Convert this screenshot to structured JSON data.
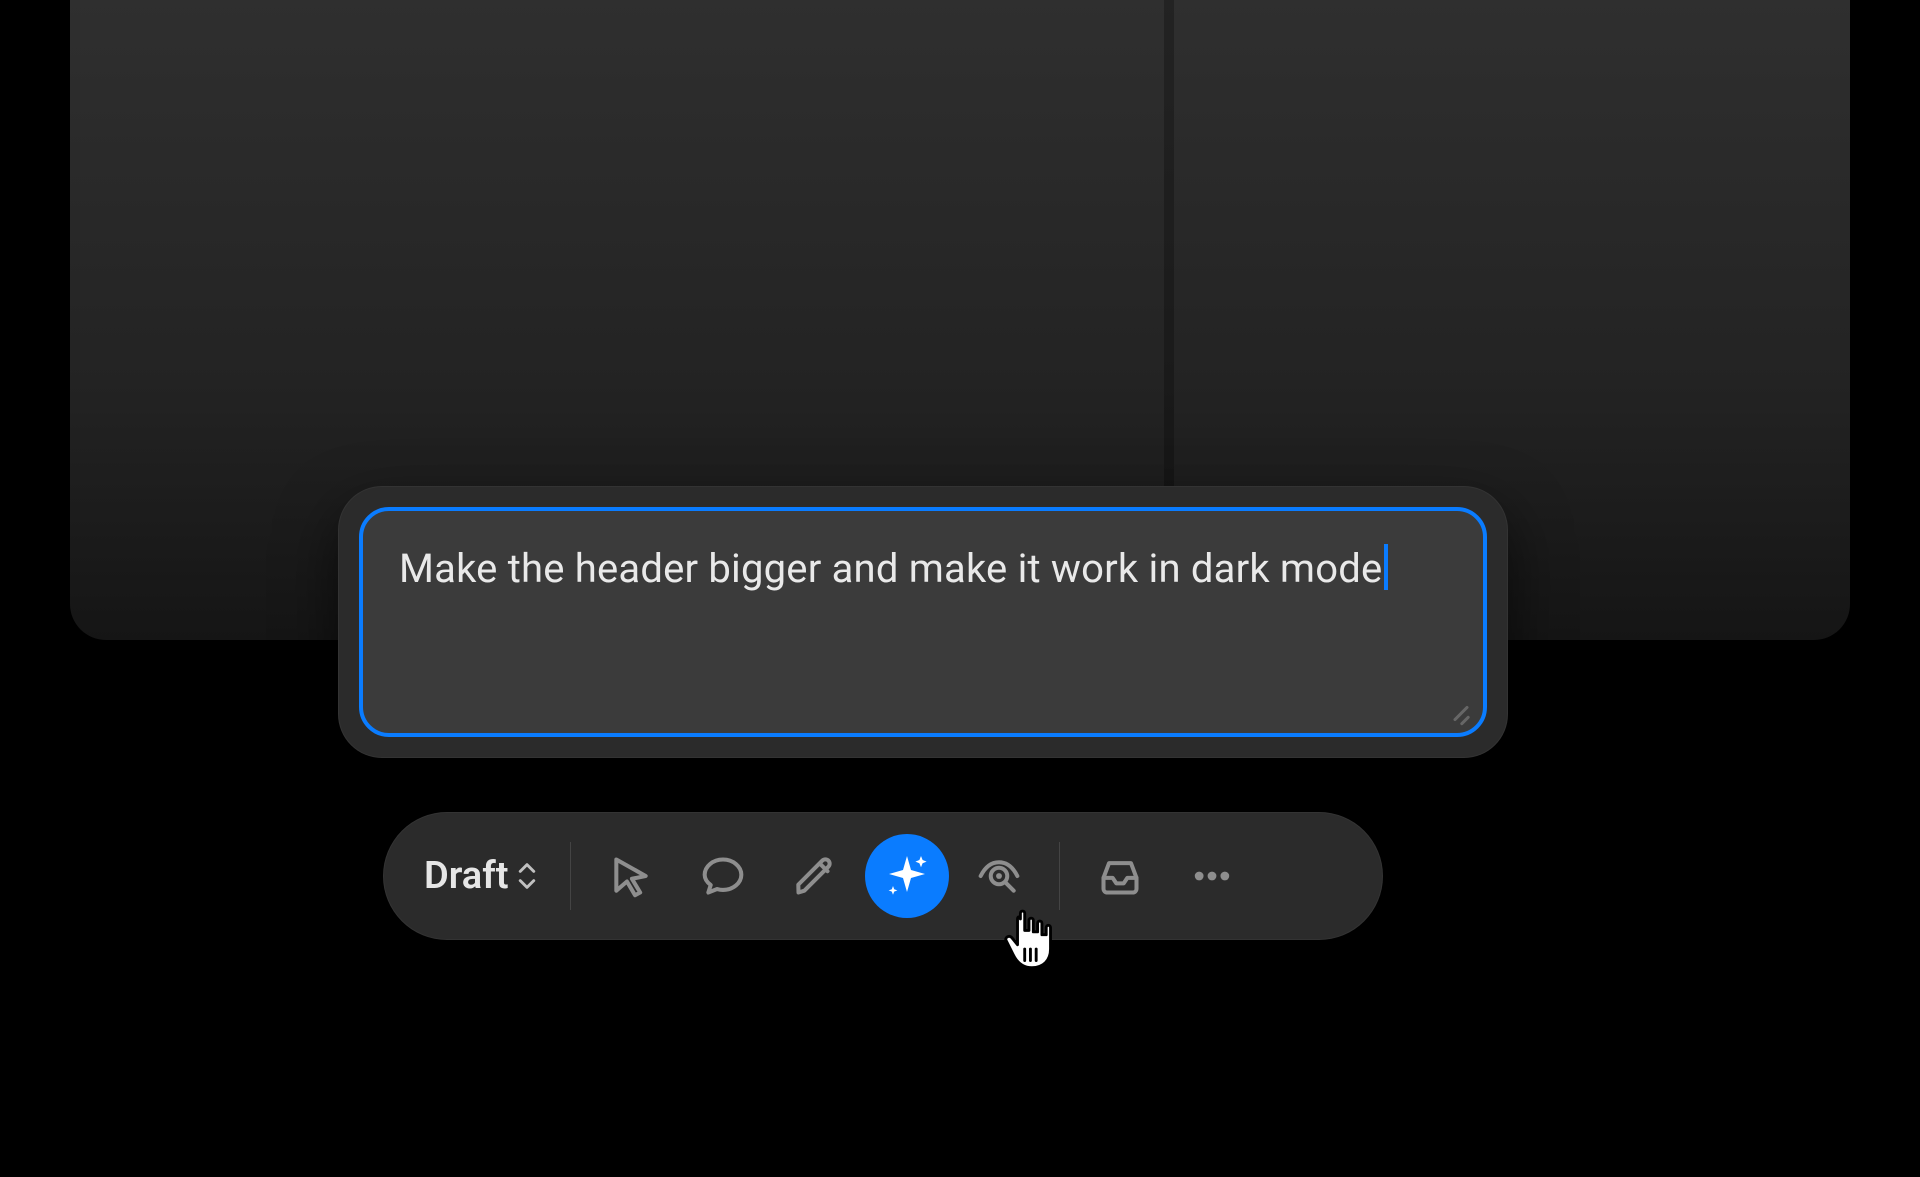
{
  "prompt": {
    "text": "Make the header bigger and make it work in dark mode"
  },
  "toolbar": {
    "mode_label": "Draft",
    "tools": {
      "select": {
        "name": "select-tool",
        "icon": "pointer-icon"
      },
      "comment": {
        "name": "comment-tool",
        "icon": "comment-icon"
      },
      "draw": {
        "name": "draw-tool",
        "icon": "pencil-icon"
      },
      "ai": {
        "name": "ai-tool",
        "icon": "sparkle-icon",
        "active": true
      },
      "inspect": {
        "name": "inspect-tool",
        "icon": "eye-target-icon"
      },
      "inbox": {
        "name": "inbox-tool",
        "icon": "inbox-icon"
      },
      "more": {
        "name": "more-tool",
        "icon": "more-icon"
      }
    }
  },
  "colors": {
    "accent": "#0a7cff",
    "panel": "#2b2b2b",
    "input_bg": "#3b3b3b",
    "icon_muted": "#8e8e8e"
  }
}
